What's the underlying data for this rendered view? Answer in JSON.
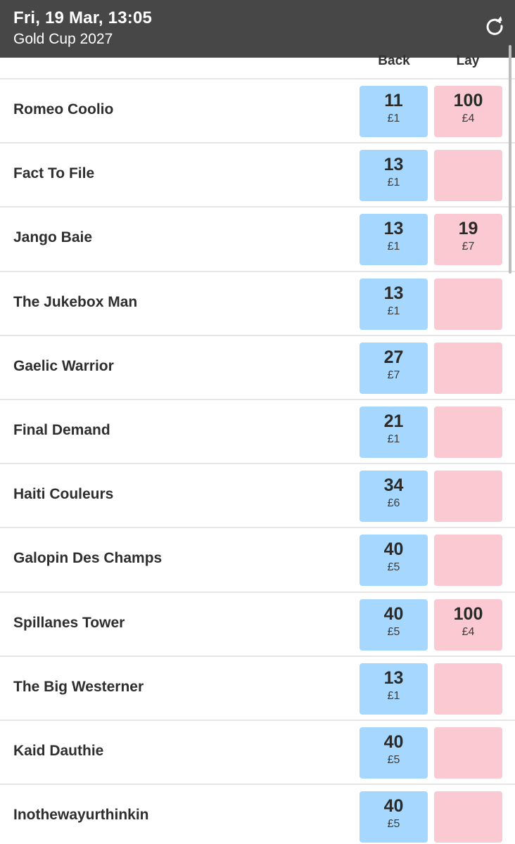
{
  "header": {
    "time": "Fri, 19 Mar, 13:05",
    "event": "Gold Cup 2027",
    "refresh_icon": "refresh-icon"
  },
  "columns": {
    "back": "Back",
    "lay": "Lay"
  },
  "colors": {
    "header_bg": "#474747",
    "back_bg": "#a6d8ff",
    "lay_bg": "#fac9d1"
  },
  "runners": [
    {
      "name": "Romeo Coolio",
      "back_price": "11",
      "back_stake": "£1",
      "lay_price": "100",
      "lay_stake": "£4"
    },
    {
      "name": "Fact To File",
      "back_price": "13",
      "back_stake": "£1",
      "lay_price": "",
      "lay_stake": ""
    },
    {
      "name": "Jango Baie",
      "back_price": "13",
      "back_stake": "£1",
      "lay_price": "19",
      "lay_stake": "£7"
    },
    {
      "name": "The Jukebox Man",
      "back_price": "13",
      "back_stake": "£1",
      "lay_price": "",
      "lay_stake": ""
    },
    {
      "name": "Gaelic Warrior",
      "back_price": "27",
      "back_stake": "£7",
      "lay_price": "",
      "lay_stake": ""
    },
    {
      "name": "Final Demand",
      "back_price": "21",
      "back_stake": "£1",
      "lay_price": "",
      "lay_stake": ""
    },
    {
      "name": "Haiti Couleurs",
      "back_price": "34",
      "back_stake": "£6",
      "lay_price": "",
      "lay_stake": ""
    },
    {
      "name": "Galopin Des Champs",
      "back_price": "40",
      "back_stake": "£5",
      "lay_price": "",
      "lay_stake": ""
    },
    {
      "name": "Spillanes Tower",
      "back_price": "40",
      "back_stake": "£5",
      "lay_price": "100",
      "lay_stake": "£4"
    },
    {
      "name": "The Big Westerner",
      "back_price": "13",
      "back_stake": "£1",
      "lay_price": "",
      "lay_stake": ""
    },
    {
      "name": "Kaid Dauthie",
      "back_price": "40",
      "back_stake": "£5",
      "lay_price": "",
      "lay_stake": ""
    },
    {
      "name": "Inothewayurthinkin",
      "back_price": "40",
      "back_stake": "£5",
      "lay_price": "",
      "lay_stake": ""
    }
  ]
}
